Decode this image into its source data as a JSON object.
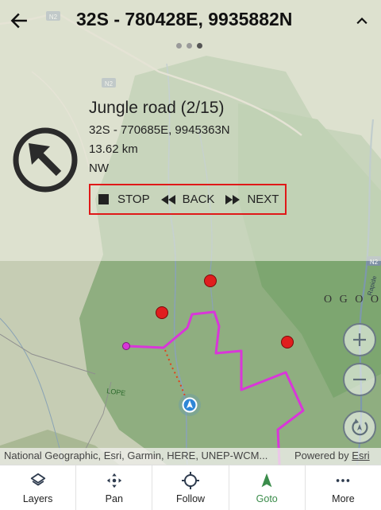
{
  "header": {
    "title": "32S - 780428E, 9935882N",
    "page_count": 3,
    "active_page": 2
  },
  "waypoint": {
    "name": "Jungle road (2/15)",
    "coordinates": "32S - 770685E, 9945363N",
    "distance": "13.62 km",
    "bearing": "NW"
  },
  "controls": {
    "stop_label": "STOP",
    "back_label": "BACK",
    "next_label": "NEXT"
  },
  "map": {
    "road_labels": [
      "N2",
      "N2",
      "N2"
    ],
    "place_label": "LOPE",
    "region_label": "O G O O",
    "river_label": "Rapide",
    "route_color": "#d936d9",
    "marker_color": "#e01e1e"
  },
  "attribution": {
    "sources": "National Geographic, Esri, Garmin, HERE, UNEP-WCM...",
    "powered_by": "Powered by",
    "esri_link": "Esri"
  },
  "nav": {
    "items": [
      {
        "label": "Layers",
        "icon": "layers-icon"
      },
      {
        "label": "Pan",
        "icon": "pan-icon"
      },
      {
        "label": "Follow",
        "icon": "crosshair-icon"
      },
      {
        "label": "Goto",
        "icon": "navigation-icon"
      },
      {
        "label": "More",
        "icon": "more-icon"
      }
    ],
    "active": "Goto",
    "active_color": "#3a8c4a"
  }
}
